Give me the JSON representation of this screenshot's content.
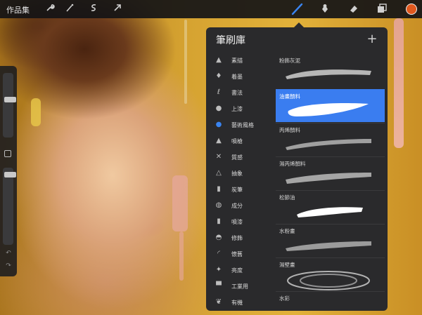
{
  "topbar": {
    "gallery_label": "作品集",
    "tools_left": [
      "wrench-icon",
      "magic-wand-icon",
      "selection-icon",
      "transform-arrow-icon"
    ],
    "tools_right": [
      "brush-icon",
      "smudge-icon",
      "eraser-icon",
      "layers-icon"
    ],
    "active_color": "#e0581e",
    "accent": "#3a84f0"
  },
  "brush_library": {
    "title": "筆刷庫",
    "add_label": "+",
    "categories": [
      {
        "label": "素描",
        "icon": "pencil-icon"
      },
      {
        "label": "着墨",
        "icon": "ink-drop-icon"
      },
      {
        "label": "書法",
        "icon": "calligraphy-icon"
      },
      {
        "label": "上漆",
        "icon": "paint-drop-icon"
      },
      {
        "label": "藝術風格",
        "icon": "art-drop-icon",
        "active": true
      },
      {
        "label": "噴槍",
        "icon": "airbrush-icon"
      },
      {
        "label": "質感",
        "icon": "texture-icon"
      },
      {
        "label": "抽象",
        "icon": "triangle-icon"
      },
      {
        "label": "炭筆",
        "icon": "charcoal-icon"
      },
      {
        "label": "成分",
        "icon": "elements-icon"
      },
      {
        "label": "噴漆",
        "icon": "spray-icon"
      },
      {
        "label": "修飾",
        "icon": "touchup-icon"
      },
      {
        "label": "懷舊",
        "icon": "retro-icon"
      },
      {
        "label": "亮度",
        "icon": "sparkle-icon"
      },
      {
        "label": "工業用",
        "icon": "anvil-icon"
      },
      {
        "label": "有機",
        "icon": "leaf-icon"
      }
    ],
    "brushes": [
      {
        "name": "粉飾灰泥"
      },
      {
        "name": "油畫顏料",
        "active": true
      },
      {
        "name": "丙烯顏料"
      },
      {
        "name": "濕丙烯顏料"
      },
      {
        "name": "松節油"
      },
      {
        "name": "水粉畫"
      },
      {
        "name": "濕壁畫"
      },
      {
        "name": "水彩"
      }
    ]
  }
}
